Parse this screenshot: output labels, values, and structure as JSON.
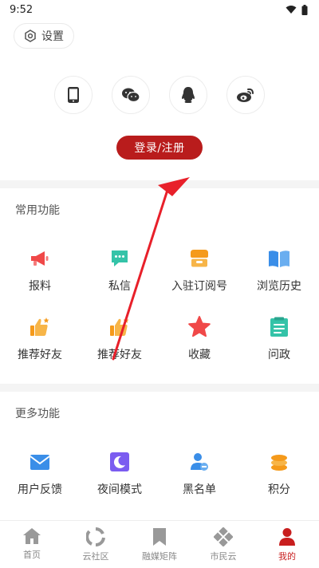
{
  "status_bar": {
    "time": "9:52"
  },
  "settings": {
    "label": "设置"
  },
  "login": {
    "label": "登录/注册"
  },
  "common": {
    "title": "常用功能",
    "items": [
      {
        "label": "报料",
        "icon": "megaphone-icon"
      },
      {
        "label": "私信",
        "icon": "chat-icon"
      },
      {
        "label": "入驻订阅号",
        "icon": "store-icon"
      },
      {
        "label": "浏览历史",
        "icon": "book-icon"
      },
      {
        "label": "推荐好友",
        "icon": "thumbs-up-icon"
      },
      {
        "label": "推荐好友",
        "icon": "thumbs-up-icon"
      },
      {
        "label": "收藏",
        "icon": "star-icon"
      },
      {
        "label": "问政",
        "icon": "list-icon"
      }
    ]
  },
  "more": {
    "title": "更多功能",
    "items": [
      {
        "label": "用户反馈",
        "icon": "mail-icon"
      },
      {
        "label": "夜间模式",
        "icon": "moon-icon"
      },
      {
        "label": "黑名单",
        "icon": "block-user-icon"
      },
      {
        "label": "积分",
        "icon": "coins-icon"
      }
    ]
  },
  "tabs": [
    {
      "label": "首页",
      "icon": "home-icon"
    },
    {
      "label": "云社区",
      "icon": "community-icon"
    },
    {
      "label": "融媒矩阵",
      "icon": "bookmark-icon"
    },
    {
      "label": "市民云",
      "icon": "diamond-icon"
    },
    {
      "label": "我的",
      "icon": "user-icon",
      "active": true
    }
  ],
  "colors": {
    "accent": "#b91c1c",
    "orange": "#f59a1b",
    "teal": "#34c3a8",
    "blue": "#3a8ee8",
    "purple": "#7b5cf0",
    "red": "#f04848"
  }
}
